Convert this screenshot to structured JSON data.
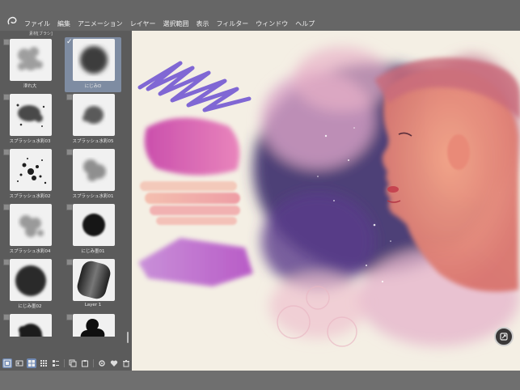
{
  "menu": {
    "items": [
      "ファイル",
      "編集",
      "アニメーション",
      "レイヤー",
      "選択範囲",
      "表示",
      "フィルター",
      "ウィンドウ",
      "ヘルプ"
    ]
  },
  "panel": {
    "header": "素材[ブラシ]",
    "cells": [
      {
        "label": "滲れ大",
        "selected": false
      },
      {
        "label": "にじみD",
        "selected": true
      },
      {
        "label": "スプラッシュ水彩03",
        "selected": false
      },
      {
        "label": "スプラッシュ水彩05",
        "selected": false
      },
      {
        "label": "スプラッシュ水彩02",
        "selected": false
      },
      {
        "label": "スプラッシュ水彩01",
        "selected": false
      },
      {
        "label": "スプラッシュ水彩04",
        "selected": false
      },
      {
        "label": "にじみ墨01",
        "selected": false
      },
      {
        "label": "にじみ墨02",
        "selected": false
      },
      {
        "label": "Layer 1",
        "selected": false
      },
      {
        "label": "",
        "selected": false
      },
      {
        "label": "",
        "selected": false
      }
    ]
  },
  "colors": {
    "menubar": "#666666",
    "panel": "#5b5b5b",
    "selection": "#7e8ca2",
    "canvas": "#f4efe4",
    "accent": "#6f89b4"
  },
  "icons": {
    "logo": "app-logo-icon",
    "toolbar": [
      "view-small-icon",
      "view-medium-icon",
      "view-large-icon",
      "grid-icon",
      "list-icon",
      "copy-icon",
      "paste-icon",
      "settings-icon",
      "heart-icon",
      "trash-icon"
    ],
    "float": "transform-icon"
  }
}
